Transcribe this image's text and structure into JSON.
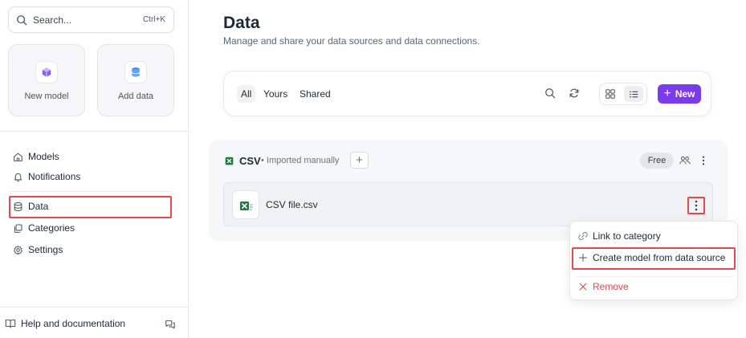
{
  "sidebar": {
    "search": {
      "placeholder": "Search...",
      "shortcut": "Ctrl+K"
    },
    "quick_actions": [
      {
        "label": "New model",
        "icon": "cube-icon"
      },
      {
        "label": "Add data",
        "icon": "database-icon"
      }
    ],
    "nav": [
      {
        "label": "Models",
        "icon": "home-icon"
      },
      {
        "label": "Notifications",
        "icon": "bell-icon"
      },
      {
        "label": "Data",
        "icon": "database-icon"
      },
      {
        "label": "Categories",
        "icon": "copy-icon"
      },
      {
        "label": "Settings",
        "icon": "gear-icon"
      }
    ],
    "footer": {
      "help_label": "Help and documentation"
    }
  },
  "main": {
    "title": "Data",
    "subtitle": "Manage and share your data sources and data connections.",
    "tabs": [
      {
        "label": "All"
      },
      {
        "label": "Yours"
      },
      {
        "label": "Shared"
      }
    ],
    "new_button_label": "New",
    "source": {
      "name": "CSV",
      "meta": "• Imported manually",
      "badge": "Free",
      "files": [
        {
          "name": "CSV file.csv"
        }
      ]
    },
    "context_menu": [
      {
        "label": "Link to category",
        "icon": "link-icon"
      },
      {
        "label": "Create model from data source",
        "icon": "plus-icon"
      },
      {
        "label": "Remove",
        "icon": "x-icon"
      }
    ]
  },
  "colors": {
    "accent": "#7c3aed",
    "danger": "#e5484d",
    "excel_green": "#1d7a43"
  }
}
